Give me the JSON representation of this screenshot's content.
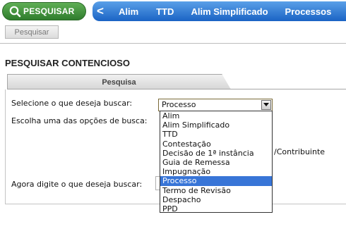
{
  "topnav": {
    "search_button_label": "PESQUISAR",
    "back_glyph": "<",
    "items": [
      "Alim",
      "TTD",
      "Alim Simplificado",
      "Processos"
    ]
  },
  "toolbar": {
    "search_label": "Pesquisar"
  },
  "page": {
    "title": "PESQUISAR CONTENCIOSO"
  },
  "panel": {
    "tab_label": "Pesquisa",
    "select_prompt": "Selecione o que deseja buscar:",
    "options_prompt": "Escolha uma das opções de busca:",
    "search_prompt": "Agora digite o que deseja buscar:",
    "obscured_text": "/Contribuinte"
  },
  "select": {
    "value": "Processo",
    "options": [
      "Alim",
      "Alim Simplificado",
      "TTD",
      "Contestação",
      "Decisão de 1ª instância",
      "Guia de Remessa",
      "Impugnação",
      "Processo",
      "Termo de Revisão",
      "Despacho",
      "PPD"
    ],
    "highlighted_index": 7
  },
  "colors": {
    "green_pill": "#3f8f3a",
    "blue_nav": "#2a76d6",
    "highlight": "#3875d7"
  }
}
